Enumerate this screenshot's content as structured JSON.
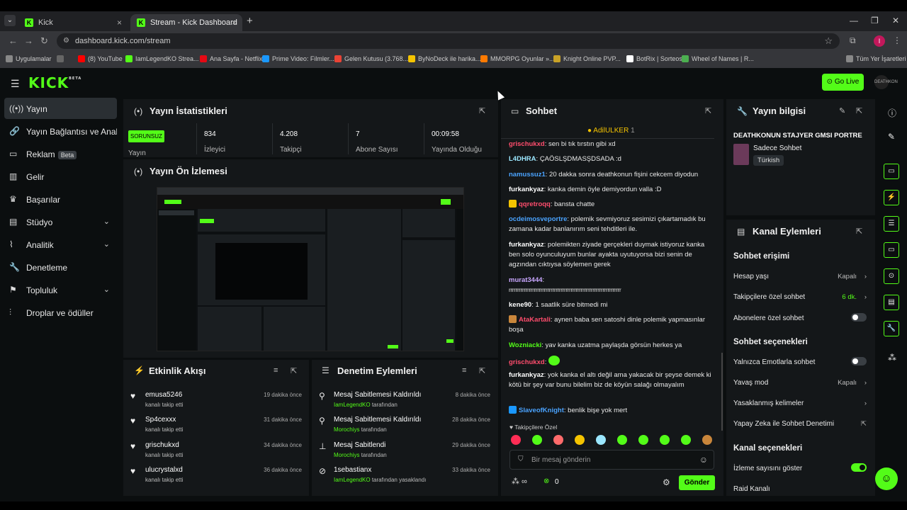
{
  "browser": {
    "tabs": [
      {
        "title": "Kick"
      },
      {
        "title": "Stream - Kick Dashboard"
      }
    ],
    "url": "dashboard.kick.com/stream",
    "profile_initial": "I",
    "bookmarks": [
      {
        "label": "Uygulamalar",
        "color": "#888888"
      },
      {
        "label": "(8) YouTube",
        "color": "#ff0000"
      },
      {
        "label": "IamLegendKO Strea...",
        "color": "#53fc18"
      },
      {
        "label": "Ana Sayfa - Netflix",
        "color": "#e50914"
      },
      {
        "label": "Prime Video: Filmler...",
        "color": "#1a98ff"
      },
      {
        "label": "Gelen Kutusu (3.768...",
        "color": "#ea4335"
      },
      {
        "label": "ByNoDeck ile harika...",
        "color": "#f5c400"
      },
      {
        "label": "MMORPG Oyunlar »...",
        "color": "#ff7a00"
      },
      {
        "label": "Knight Online PVP...",
        "color": "#c9a227"
      },
      {
        "label": "BotRix | Sorteos",
        "color": "#ffffff"
      },
      {
        "label": "Wheel of Names | R...",
        "color": "#4caf50"
      },
      {
        "label": "Tüm Yer İşaretleri",
        "color": "#888888"
      }
    ]
  },
  "header": {
    "logo": "KICK",
    "logo_badge": "BETA",
    "go_live": "Go Live",
    "avatar_text": "DEATHKON"
  },
  "sidebar": {
    "items": [
      {
        "label": "Yayın",
        "icon": "broadcast-icon",
        "active": true
      },
      {
        "label": "Yayın Bağlantısı ve Anahtar",
        "icon": "link-icon"
      },
      {
        "label": "Reklam",
        "icon": "ad-icon",
        "badge": "Beta"
      },
      {
        "label": "Gelir",
        "icon": "money-icon"
      },
      {
        "label": "Başarılar",
        "icon": "trophy-icon"
      },
      {
        "label": "Stüdyo",
        "icon": "studio-icon",
        "expandable": true
      },
      {
        "label": "Analitik",
        "icon": "chart-icon",
        "expandable": true
      },
      {
        "label": "Denetleme",
        "icon": "wrench-icon"
      },
      {
        "label": "Topluluk",
        "icon": "community-icon",
        "expandable": true
      },
      {
        "label": "Droplar ve ödüller",
        "icon": "drops-icon"
      }
    ]
  },
  "stats_panel": {
    "title": "Yayın İstatistikleri",
    "status": "SORUNSUZ",
    "status_label": "Yayın",
    "stats": [
      {
        "value": "834",
        "label": "İzleyici"
      },
      {
        "value": "4.208",
        "label": "Takipçi"
      },
      {
        "value": "7",
        "label": "Abone Sayısı"
      },
      {
        "value": "00:09:58",
        "label": "Yayında Olduğu"
      }
    ]
  },
  "preview_panel": {
    "title": "Yayın Ön İzlemesi"
  },
  "activity_panel": {
    "title": "Etkinlik Akışı",
    "items": [
      {
        "name": "emusa5246",
        "action": "kanalı takip etti",
        "time": "19 dakika önce"
      },
      {
        "name": "Sp4cexxx",
        "action": "kanalı takip etti",
        "time": "31 dakika önce"
      },
      {
        "name": "grischukxd",
        "action": "kanalı takip etti",
        "time": "34 dakika önce"
      },
      {
        "name": "ulucrystalxd",
        "action": "kanalı takip etti",
        "time": "36 dakika önce"
      }
    ]
  },
  "moderation_panel": {
    "title": "Denetim Eylemleri",
    "items": [
      {
        "action": "Mesaj Sabitlemesi Kaldırıldı",
        "by": "IamLegendKO",
        "suffix": "tarafından",
        "time": "8 dakika önce",
        "icon": "unpin-icon"
      },
      {
        "action": "Mesaj Sabitlemesi Kaldırıldı",
        "by": "Morochiys",
        "suffix": "tarafından",
        "time": "28 dakika önce",
        "icon": "unpin-icon"
      },
      {
        "action": "Mesaj Sabitlendi",
        "by": "Morochiys",
        "suffix": "tarafından",
        "time": "29 dakika önce",
        "icon": "pin-icon"
      },
      {
        "action": "1sebastianx",
        "by": "IamLegendKO",
        "suffix": "tarafından yasaklandı",
        "time": "33 dakika önce",
        "icon": "ban-icon"
      }
    ]
  },
  "chat_panel": {
    "title": "Sohbet",
    "pinned_user": "AdilULKER",
    "pinned_count": "1",
    "messages": [
      {
        "user": "grischukxd",
        "color": "#ff4d6d",
        "text": "sen bi tık tırstın gibi xd"
      },
      {
        "user": "L4DHRA",
        "color": "#9be7ff",
        "text": "ÇAÖSLŞDMASŞDSADA :d"
      },
      {
        "user": "namussuz1",
        "color": "#4aa3ff",
        "text": "20 dakka sonra deathkonun fişini cekcem diyodun"
      },
      {
        "user": "furkankyaz",
        "color": "#ffffff",
        "text": "kanka demin öyle demiyordun valla :D"
      },
      {
        "user": "qqretroqq",
        "color": "#ff4d6d",
        "text": "bansta chatte",
        "badge": "#f5c400"
      },
      {
        "user": "ocdeimosveportre",
        "color": "#4aa3ff",
        "text": "polemik sevmiyoruz sesimizi çıkartamadık bu zamana kadar banlanırım seni tehditleri ile."
      },
      {
        "user": "furkankyaz",
        "color": "#ffffff",
        "text": "polemikten ziyade gerçekleri duymak istiyoruz kanka ben solo oyunculuyum bunlar ayakta uyutuyorsa bizi senin de agzından cıktıysa söylemen gerek"
      },
      {
        "user": "murat3444",
        "color": "#c9a7ff",
        "text": "rrrrrrrrrrrrrrrrrrrrrrrrrrrrrrrrrrrrrrrrrrrrrrrrrrrrrrrrrrrrrrrrrrr"
      },
      {
        "user": "kene90",
        "color": "#ffffff",
        "text": "1 saatlik süre bitmedi mi"
      },
      {
        "user": "AtaKartali",
        "color": "#ff4d6d",
        "text": "aynen baba sen satoshi dinle polemik yapmasınlar boşa",
        "badge": "#c9863b"
      },
      {
        "user": "Wozniacki",
        "color": "#53fc18",
        "text": "yav kanka uzatma paylaşda görsün herkes ya"
      },
      {
        "user": "grischukxd",
        "color": "#ff4d6d",
        "text": ""
      },
      {
        "user": "furkankyaz",
        "color": "#ffffff",
        "text": "yok kanka el altı değil ama yakacak bir şeyse demek ki kötü bir şey var bunu bilelim biz de köyün salağı olmayalım"
      },
      {
        "user": "SlaveofKnight",
        "color": "#4aa3ff",
        "text": "benlik bişe yok mert",
        "badge": "#1a98ff"
      }
    ],
    "follower_only_label": "Takipçilere Özel",
    "emote_colors": [
      "#ff2d55",
      "#53fc18",
      "#ff6b6b",
      "#f5c400",
      "#9be7ff",
      "#53fc18",
      "#53fc18",
      "#53fc18",
      "#53fc18",
      "#c9863b"
    ],
    "input_placeholder": "Bir mesaj gönderin",
    "count_label": "0",
    "send_label": "Gönder"
  },
  "stream_info_panel": {
    "title": "Yayın bilgisi",
    "stream_title": "DEATHKONUN STAJYER GMSI PORTRE",
    "category": "Sadece Sohbet",
    "language": "Türkish"
  },
  "channel_actions_panel": {
    "title": "Kanal Eylemleri",
    "chat_access_title": "Sohbet erişimi",
    "account_age": {
      "label": "Hesap yaşı",
      "value": "Kapalı"
    },
    "follower_chat": {
      "label": "Takipçilere özel sohbet",
      "value": "6 dk."
    },
    "sub_chat": {
      "label": "Abonelere özel sohbet",
      "enabled": false
    },
    "chat_options_title": "Sohbet seçenekleri",
    "emote_only": {
      "label": "Yalnızca Emotlarla sohbet",
      "enabled": false
    },
    "slow_mode": {
      "label": "Yavaş mod",
      "value": "Kapalı"
    },
    "banned_words": {
      "label": "Yasaklanmış kelimeler"
    },
    "ai_moderation": {
      "label": "Yapay Zeka ile Sohbet Denetimi"
    },
    "channel_options_title": "Kanal seçenekleri",
    "show_viewers": {
      "label": "İzleme sayısını göster",
      "enabled": true
    },
    "raid": {
      "label": "Raid Kanalı"
    }
  }
}
